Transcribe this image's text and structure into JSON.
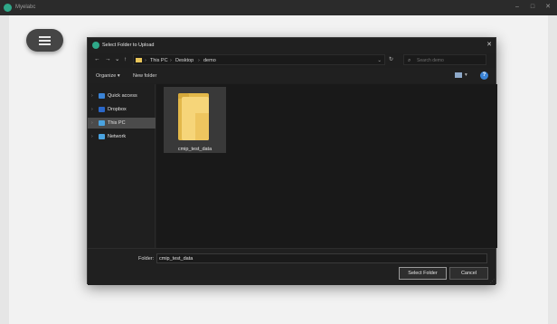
{
  "app": {
    "title": "Myelabc"
  },
  "window_controls": {
    "minimize": "–",
    "maximize": "□",
    "close": "✕"
  },
  "dialog": {
    "title": "Select Folder to Upload",
    "close": "✕",
    "nav": {
      "back": "←",
      "forward": "→",
      "recent": "⌄",
      "up": "↑"
    },
    "breadcrumb": [
      {
        "label": "This PC"
      },
      {
        "label": "Desktop"
      },
      {
        "label": "demo"
      }
    ],
    "breadcrumb_sep": "›",
    "path_dropdown": "⌄",
    "refresh": "↻",
    "search": {
      "placeholder": "Search demo",
      "icon": "⌕"
    },
    "toolbar": {
      "organize": "Organize ▾",
      "new_folder": "New folder",
      "view_dropdown": "▾",
      "help": "?"
    },
    "nav_pane": [
      {
        "label": "Quick access",
        "icon": "star-icon",
        "color": "#3a83d6",
        "chevron": "›"
      },
      {
        "label": "Dropbox",
        "icon": "dropbox-icon",
        "color": "#2a67c9",
        "chevron": "›"
      },
      {
        "label": "This PC",
        "icon": "pc-icon",
        "color": "#4aa3e0",
        "chevron": "›",
        "selected": true
      },
      {
        "label": "Network",
        "icon": "network-icon",
        "color": "#4aa3e0",
        "chevron": "›"
      }
    ],
    "items": [
      {
        "name": "cmip_test_data",
        "type": "folder"
      }
    ],
    "footer": {
      "folder_label": "Folder:",
      "folder_value": "cmip_test_data",
      "select_button": "Select Folder",
      "cancel_button": "Cancel"
    }
  },
  "colors": {
    "accent": "#2fa889",
    "folder": "#e3b84a",
    "dialog_bg": "#1f1f1f"
  }
}
